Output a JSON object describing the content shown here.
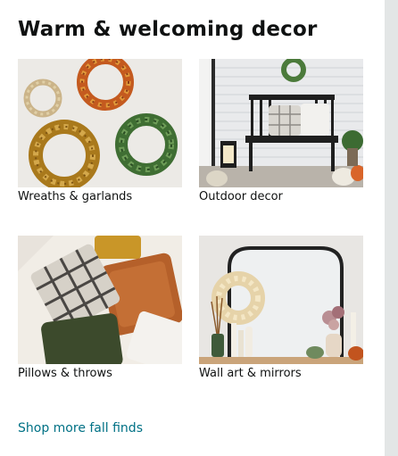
{
  "card": {
    "title": "Warm & welcoming decor",
    "tiles": [
      {
        "label": "Wreaths & garlands"
      },
      {
        "label": "Outdoor decor"
      },
      {
        "label": "Pillows & throws"
      },
      {
        "label": "Wall art & mirrors"
      }
    ],
    "footer_link": "Shop more fall finds"
  },
  "colors": {
    "link": "#007185",
    "text": "#0f1111",
    "page_bg": "#e3e6e6"
  }
}
